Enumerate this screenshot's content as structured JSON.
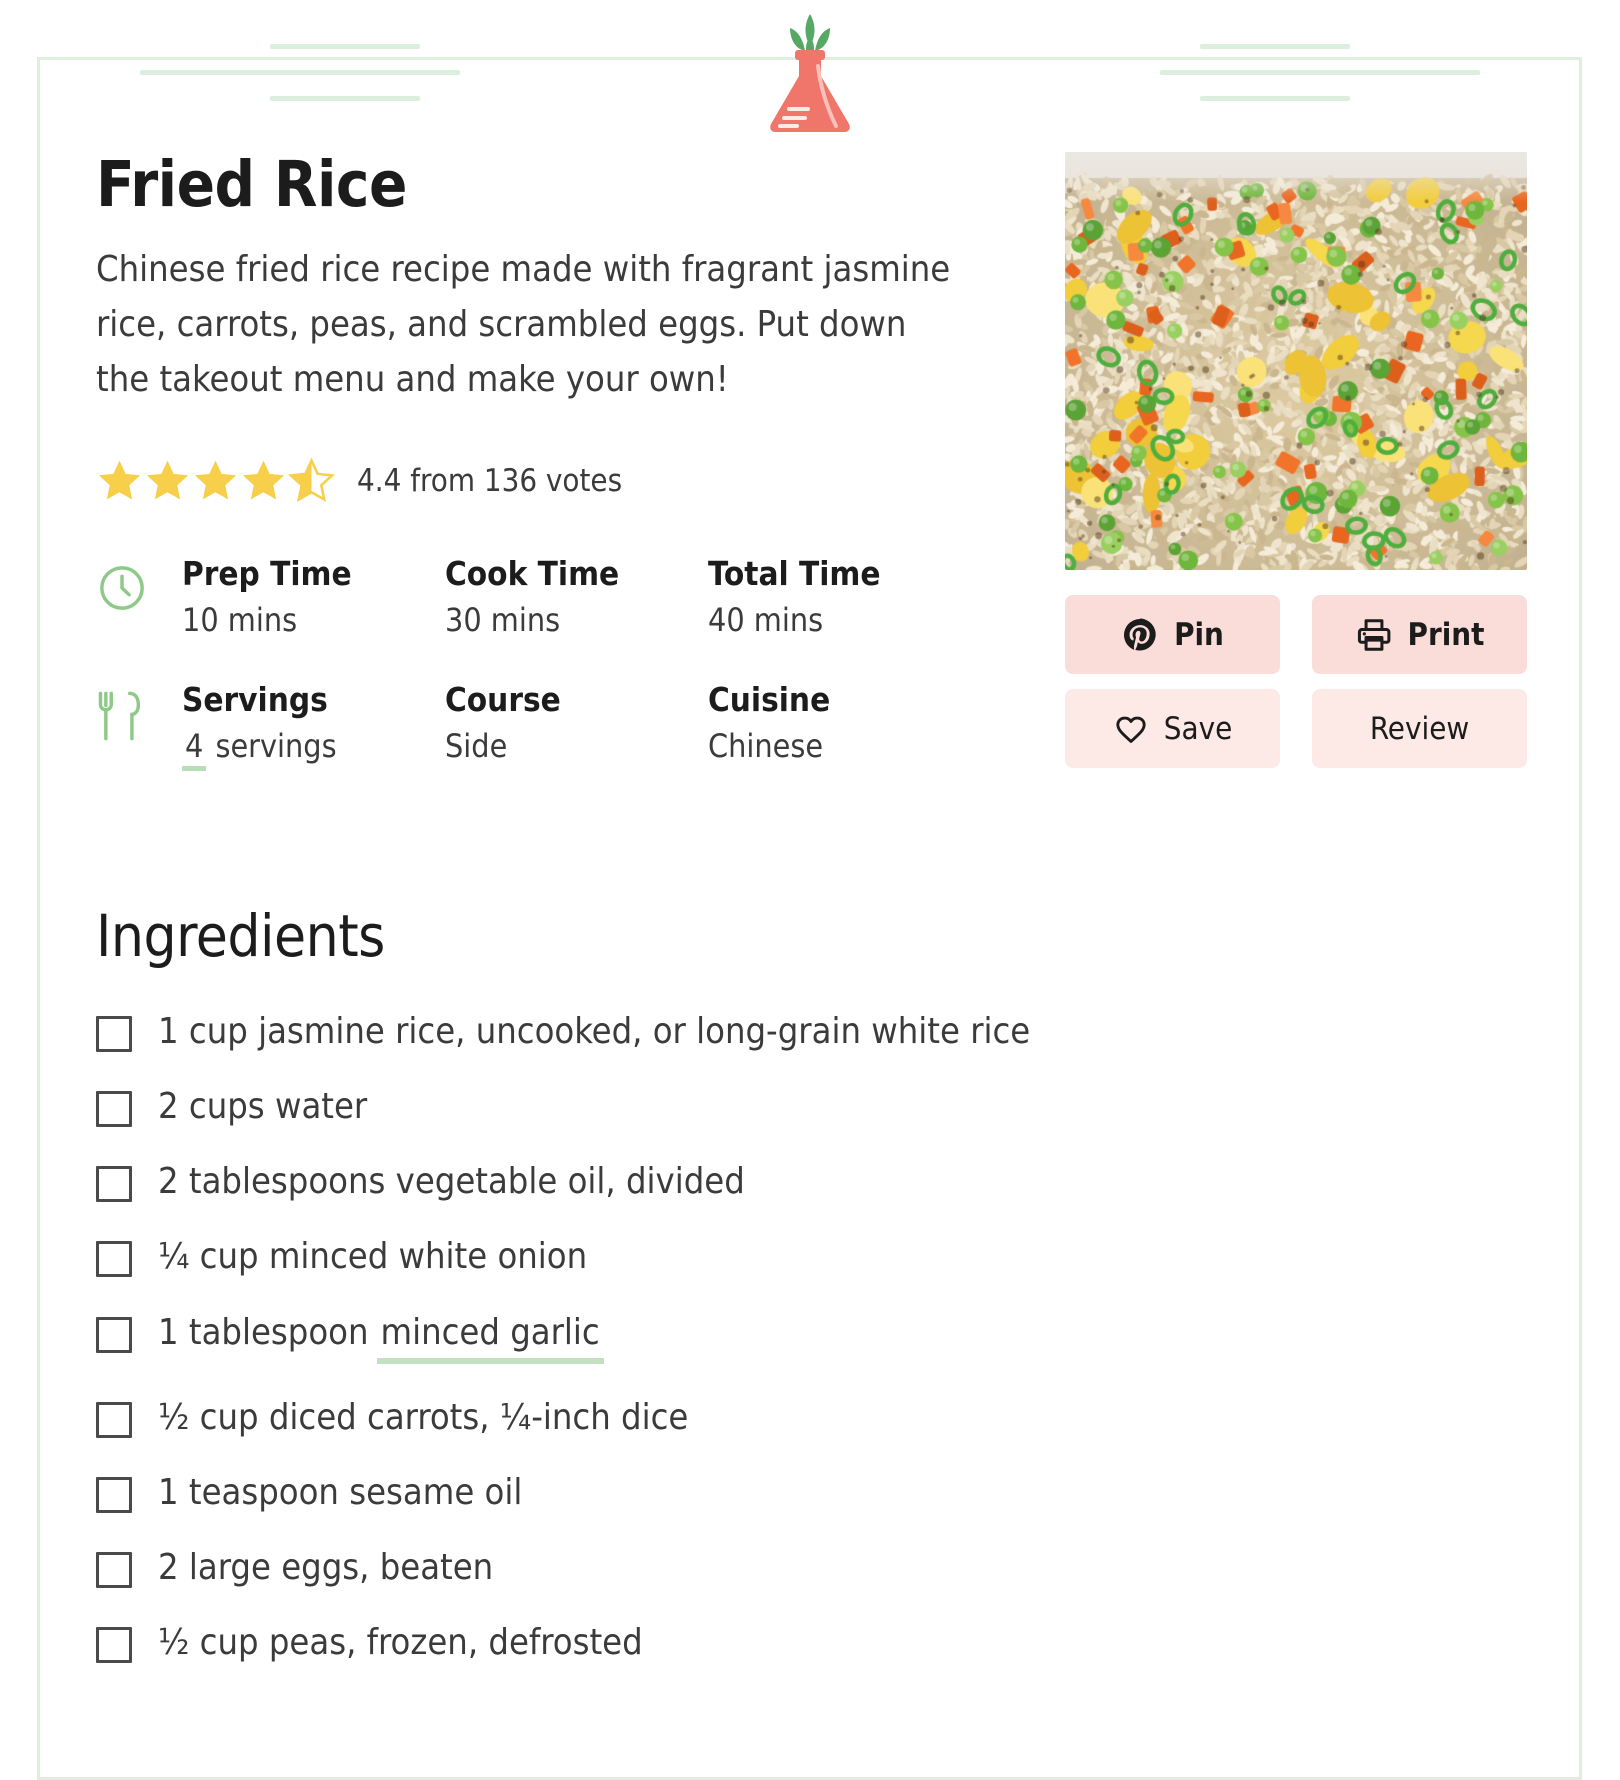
{
  "brand": {
    "logo_icon": "flask-with-leaves-icon",
    "flask_color": "#f0766b",
    "leaf_color": "#57a864",
    "deco_line_color": "#dceedd"
  },
  "recipe": {
    "title": "Fried Rice",
    "description": "Chinese fried rice recipe made with fragrant jasmine rice, carrots, peas, and scrambled eggs. Put down the takeout menu and make your own!",
    "photo_alt": "bowl of fried rice with peas, carrots, egg and green onion"
  },
  "rating": {
    "value": "4.4",
    "votes": "136",
    "summary": "4.4 from 136 votes",
    "stars_filled": 4,
    "stars_half": 1,
    "stars_total": 5,
    "star_color": "#f7cf4b"
  },
  "meta": {
    "row1_icon": "clock-icon",
    "row2_icon": "fork-knife-icon",
    "icon_color": "#8ec98a",
    "items": [
      {
        "label": "Prep Time",
        "value": "10 mins"
      },
      {
        "label": "Cook Time",
        "value": "30 mins"
      },
      {
        "label": "Total Time",
        "value": "40 mins"
      },
      {
        "label": "Servings",
        "value": "4",
        "value_suffix": "servings"
      },
      {
        "label": "Course",
        "value": "Side"
      },
      {
        "label": "Cuisine",
        "value": "Chinese"
      }
    ]
  },
  "actions": [
    {
      "label": "Pin",
      "icon": "pinterest-icon",
      "style": "primary"
    },
    {
      "label": "Print",
      "icon": "printer-icon",
      "style": "primary"
    },
    {
      "label": "Save",
      "icon": "heart-icon",
      "style": "secondary"
    },
    {
      "label": "Review",
      "icon": "none",
      "style": "secondary"
    }
  ],
  "ingredients": {
    "heading": "Ingredients",
    "items": [
      {
        "text": "1 cup jasmine rice, uncooked, or long-grain white rice"
      },
      {
        "text": "2 cups water"
      },
      {
        "text": "2 tablespoons vegetable oil, divided"
      },
      {
        "text": "¼ cup minced white onion"
      },
      {
        "text": "1 tablespoon",
        "link": "minced garlic"
      },
      {
        "text": "½ cup diced carrots, ¼-inch dice"
      },
      {
        "text": "1 teaspoon sesame oil"
      },
      {
        "text": "2 large eggs, beaten"
      },
      {
        "text": "½ cup peas, frozen, defrosted"
      }
    ]
  },
  "colors": {
    "card_border": "#dfeede",
    "button_primary_bg": "#fadcd9",
    "button_secondary_bg": "#fdeae6",
    "link_underline": "#c3e0c0",
    "text_dark": "#1c1c1c",
    "text_body": "#3b3b3b"
  }
}
